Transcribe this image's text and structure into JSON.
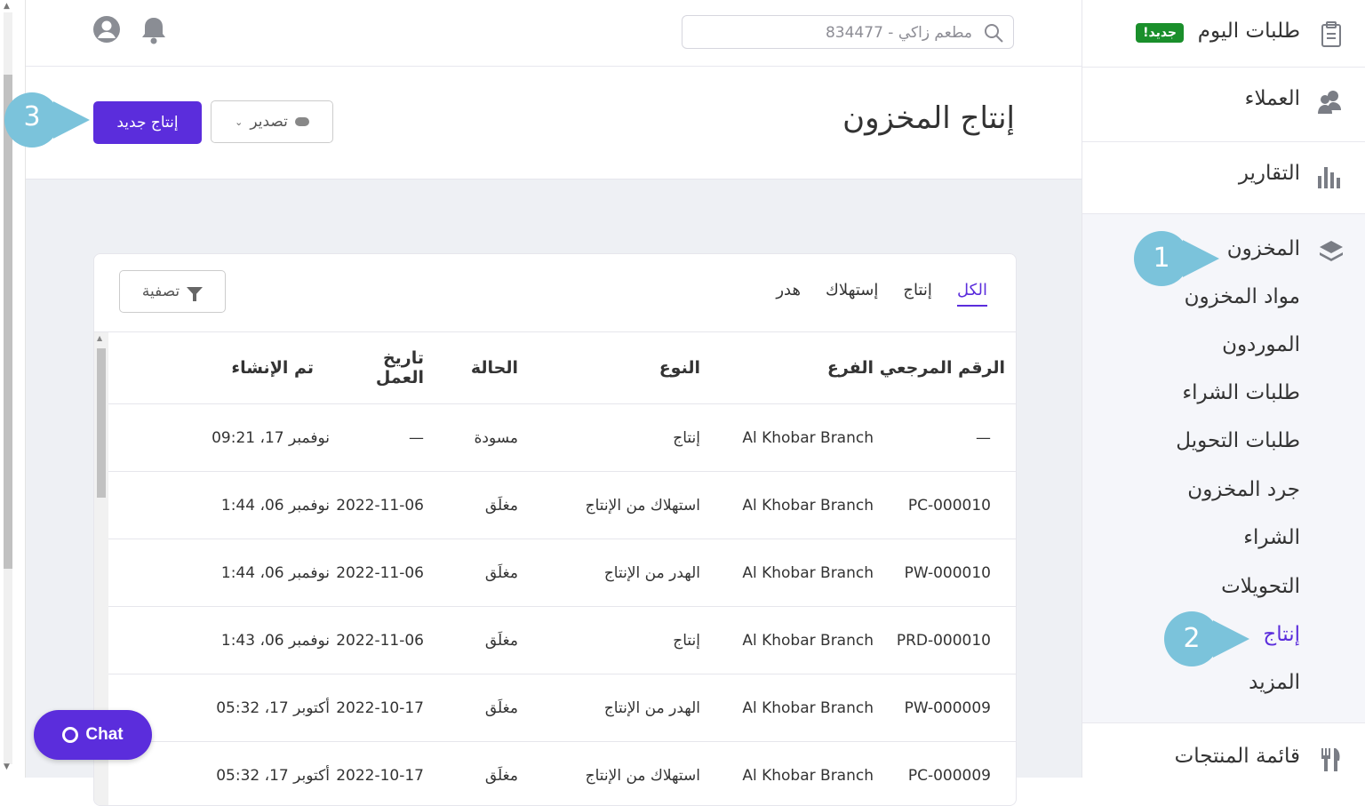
{
  "search": {
    "placeholder": "مطعم زاكي - 834477"
  },
  "header": {
    "title": "إنتاج المخزون",
    "export_label": "تصدير",
    "new_label": "إنتاج جديد"
  },
  "tabs": [
    {
      "label": "الكل"
    },
    {
      "label": "إنتاج"
    },
    {
      "label": "إستهلاك"
    },
    {
      "label": "هدر"
    }
  ],
  "filter_label": "تصفية",
  "table": {
    "headers": [
      "الرقم المرجعي",
      "الفرع",
      "النوع",
      "الحالة",
      "تاريخ العمل",
      "تم الإنشاء"
    ],
    "rows": [
      {
        "ref": "—",
        "branch": "Al Khobar Branch",
        "type": "إنتاج",
        "status": "مسودة",
        "date": "—",
        "created": "نوفمبر 17، 09:21"
      },
      {
        "ref": "PC-000010",
        "branch": "Al Khobar Branch",
        "type": "استهلاك من الإنتاج",
        "status": "مغلَق",
        "date": "2022-11-06",
        "created": "نوفمبر 06، 1:44"
      },
      {
        "ref": "PW-000010",
        "branch": "Al Khobar Branch",
        "type": "الهدر من الإنتاج",
        "status": "مغلَق",
        "date": "2022-11-06",
        "created": "نوفمبر 06، 1:44"
      },
      {
        "ref": "PRD-000010",
        "branch": "Al Khobar Branch",
        "type": "إنتاج",
        "status": "مغلَق",
        "date": "2022-11-06",
        "created": "نوفمبر 06، 1:43"
      },
      {
        "ref": "PW-000009",
        "branch": "Al Khobar Branch",
        "type": "الهدر من الإنتاج",
        "status": "مغلَق",
        "date": "2022-10-17",
        "created": "أكتوبر 17، 05:32"
      },
      {
        "ref": "PC-000009",
        "branch": "Al Khobar Branch",
        "type": "استهلاك من الإنتاج",
        "status": "مغلَق",
        "date": "2022-10-17",
        "created": "أكتوبر 17، 05:32"
      }
    ]
  },
  "sidebar": {
    "today_orders": "طلبات اليوم",
    "new_badge": "جديد!",
    "customers": "العملاء",
    "reports": "التقارير",
    "inventory": "المخزون",
    "inventory_items": [
      "مواد المخزون",
      "الموردون",
      "طلبات الشراء",
      "طلبات التحويل",
      "جرد المخزون",
      "الشراء",
      "التحويلات",
      "إنتاج",
      "المزيد"
    ],
    "menu": "قائمة المنتجات"
  },
  "callouts": [
    "1",
    "2",
    "3"
  ],
  "chat_label": "Chat",
  "colors": {
    "accent": "#5b2ddc",
    "callout": "#7bc3db",
    "badge": "#1a8f2b"
  }
}
